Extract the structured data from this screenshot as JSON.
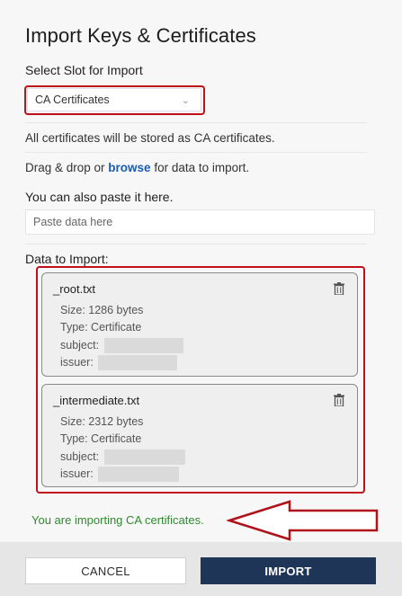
{
  "dialog": {
    "title": "Import Keys & Certificates",
    "slot_label": "Select Slot for Import",
    "slot_value": "CA Certificates",
    "info_text": "All certificates will be stored as CA certificates.",
    "drag_text_prefix": "Drag & drop or ",
    "browse_link": "browse",
    "drag_text_suffix": " for data to import.",
    "paste_label": "You can also paste it here.",
    "paste_placeholder": "Paste data here",
    "data_label": "Data to Import:",
    "files": [
      {
        "name": "_root.txt",
        "size": "Size: 1286 bytes",
        "type": "Type: Certificate",
        "subject_label": "subject:",
        "issuer_label": "issuer:"
      },
      {
        "name": "_intermediate.txt",
        "size": "Size: 2312 bytes",
        "type": "Type: Certificate",
        "subject_label": "subject:",
        "issuer_label": "issuer:"
      }
    ],
    "status_text": "You are importing CA certificates.",
    "cancel_label": "CANCEL",
    "import_label": "IMPORT"
  },
  "colors": {
    "highlight": "#c0101a",
    "link": "#1a5db3",
    "status": "#2f8a2f",
    "primary_button": "#1f3558"
  },
  "icons": [
    "chevron-down-icon",
    "trash-icon",
    "arrow-left-annotation"
  ]
}
